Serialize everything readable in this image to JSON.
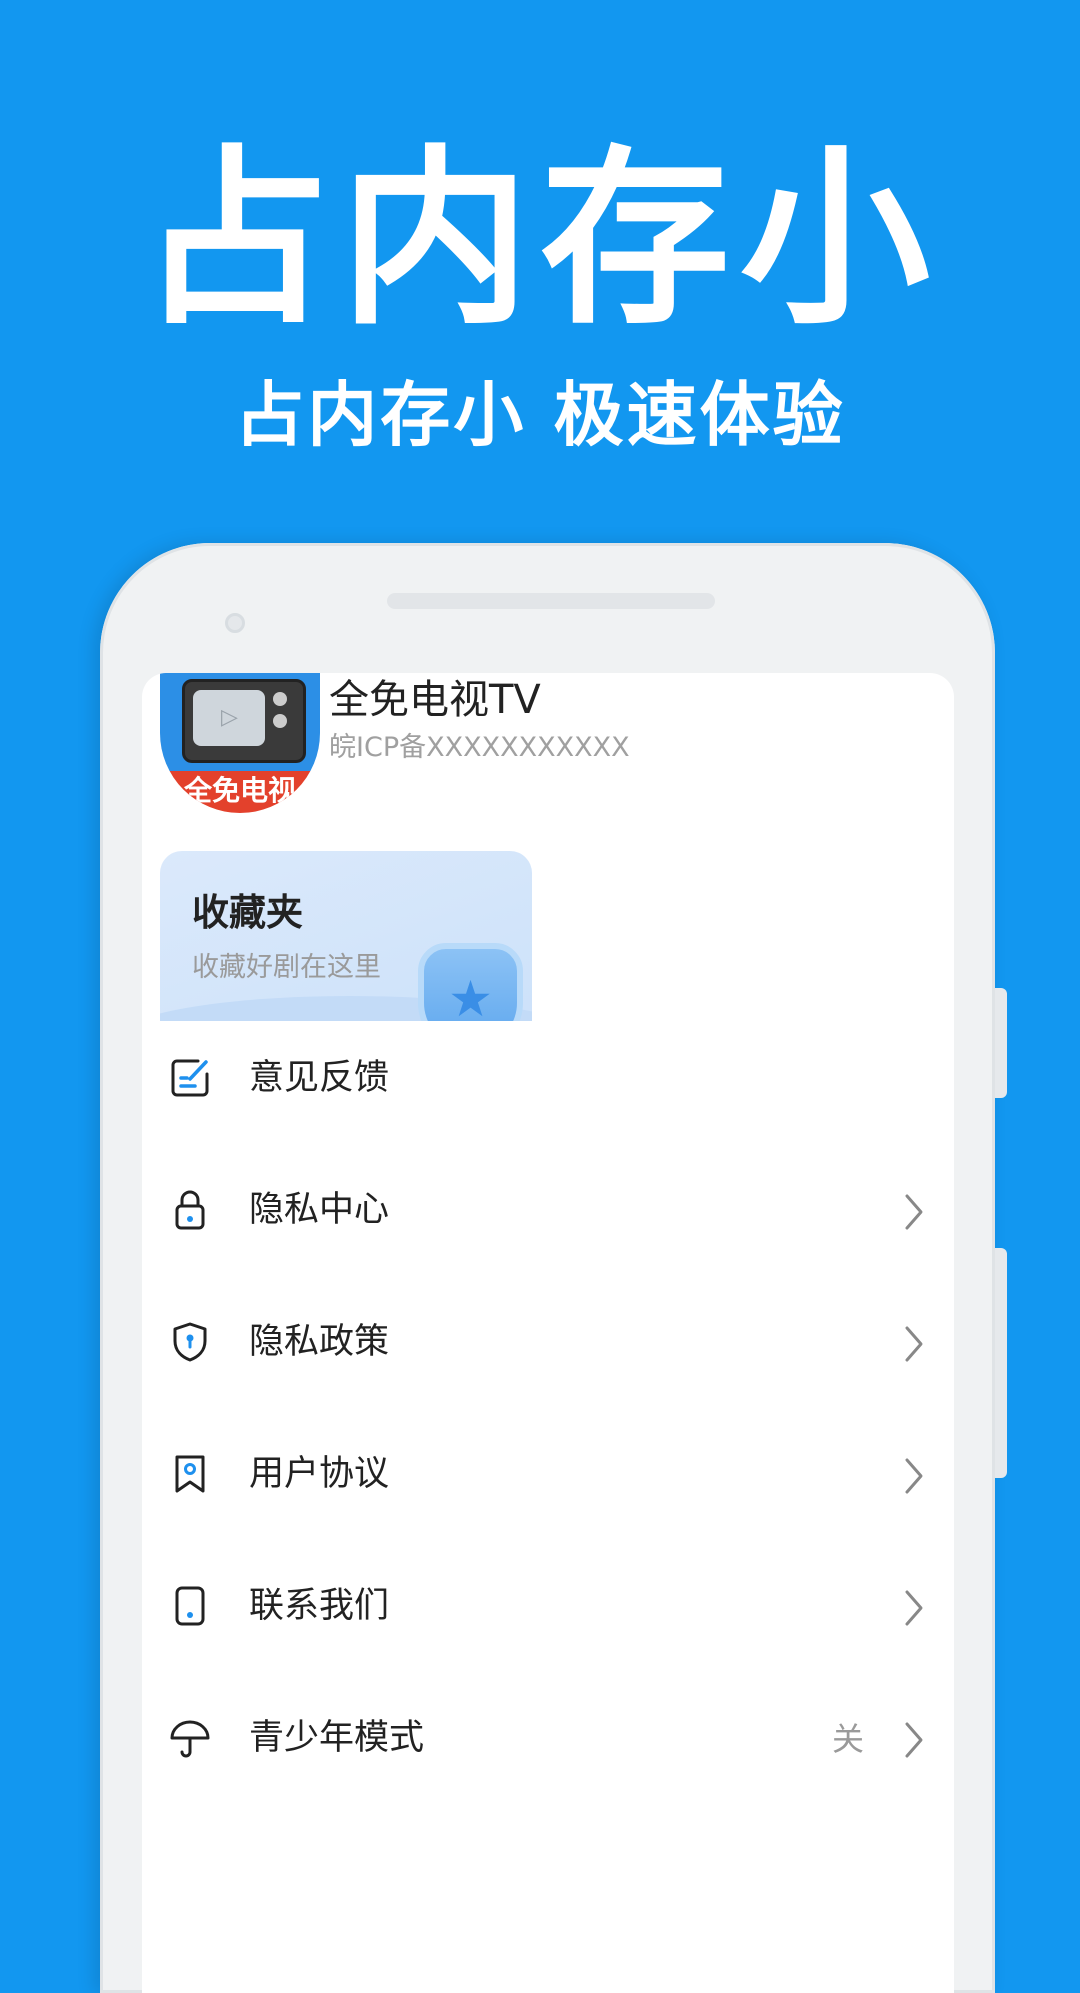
{
  "promo": {
    "title": "占内存小",
    "subtitle": "占内存小 极速体验"
  },
  "app": {
    "name": "全免电视TV",
    "icp": "皖ICP备XXXXXXXXXXX",
    "logo_text": "全免电视"
  },
  "favorites": {
    "title": "收藏夹",
    "description": "收藏好剧在这里"
  },
  "menu": [
    {
      "label": "意见反馈",
      "icon": "feedback-icon",
      "value": ""
    },
    {
      "label": "隐私中心",
      "icon": "lock-icon",
      "value": ""
    },
    {
      "label": "隐私政策",
      "icon": "shield-icon",
      "value": ""
    },
    {
      "label": "用户协议",
      "icon": "bookmark-icon",
      "value": ""
    },
    {
      "label": "联系我们",
      "icon": "phone-icon",
      "value": ""
    },
    {
      "label": "青少年模式",
      "icon": "umbrella-icon",
      "value": "关"
    }
  ],
  "colors": {
    "background": "#1297f0",
    "accent": "#2c8fe6"
  }
}
